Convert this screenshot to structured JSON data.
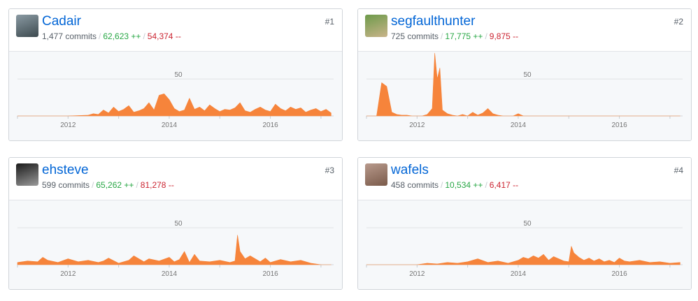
{
  "contributors": [
    {
      "username": "Cadair",
      "rank": "#1",
      "commits": "1,477 commits",
      "additions": "62,623 ++",
      "deletions": "54,374 --",
      "avatar_colors": [
        "#8a9aa3",
        "#3d4a4f"
      ]
    },
    {
      "username": "segfaulthunter",
      "rank": "#2",
      "commits": "725 commits",
      "additions": "17,775 ++",
      "deletions": "9,875 --",
      "avatar_colors": [
        "#6d9a4a",
        "#c9b48a"
      ]
    },
    {
      "username": "ehsteve",
      "rank": "#3",
      "commits": "599 commits",
      "additions": "65,262 ++",
      "deletions": "81,278 --",
      "avatar_colors": [
        "#1a1a1a",
        "#9a9a9a"
      ]
    },
    {
      "username": "wafels",
      "rank": "#4",
      "commits": "458 commits",
      "additions": "10,534 ++",
      "deletions": "6,417 --",
      "avatar_colors": [
        "#b89a8c",
        "#7a5a4a"
      ]
    }
  ],
  "chart_data": [
    {
      "type": "area",
      "series_of": "Cadair",
      "x": [
        2011.0,
        2011.5,
        2012.0,
        2012.4,
        2012.5,
        2012.6,
        2012.7,
        2012.8,
        2012.9,
        2013.0,
        2013.1,
        2013.2,
        2013.3,
        2013.4,
        2013.5,
        2013.6,
        2013.7,
        2013.8,
        2013.9,
        2014.0,
        2014.1,
        2014.2,
        2014.3,
        2014.4,
        2014.5,
        2014.6,
        2014.7,
        2014.8,
        2014.9,
        2015.0,
        2015.1,
        2015.2,
        2015.3,
        2015.4,
        2015.5,
        2015.6,
        2015.7,
        2015.8,
        2015.9,
        2016.0,
        2016.1,
        2016.2,
        2016.3,
        2016.4,
        2016.5,
        2016.6,
        2016.7,
        2016.8,
        2016.9,
        2017.0,
        2017.1,
        2017.2
      ],
      "values": [
        0,
        0,
        0,
        1,
        3,
        2,
        8,
        4,
        12,
        6,
        9,
        14,
        5,
        7,
        10,
        18,
        8,
        28,
        30,
        22,
        10,
        6,
        8,
        24,
        9,
        12,
        7,
        15,
        10,
        6,
        9,
        8,
        11,
        18,
        7,
        5,
        9,
        12,
        8,
        6,
        16,
        10,
        7,
        12,
        9,
        11,
        5,
        8,
        10,
        6,
        9,
        4
      ],
      "xlim": [
        2011.0,
        2017.25
      ],
      "ylim": [
        0,
        70
      ],
      "yticks": [
        50
      ],
      "xticks": [
        "2012",
        "2014",
        "2016"
      ],
      "color": "#f6843b"
    },
    {
      "type": "area",
      "series_of": "segfaulthunter",
      "x": [
        2011.0,
        2011.2,
        2011.3,
        2011.4,
        2011.5,
        2011.6,
        2011.7,
        2011.8,
        2011.9,
        2012.0,
        2012.1,
        2012.2,
        2012.3,
        2012.35,
        2012.4,
        2012.45,
        2012.5,
        2012.6,
        2012.7,
        2012.8,
        2012.9,
        2013.0,
        2013.1,
        2013.2,
        2013.3,
        2013.4,
        2013.5,
        2013.6,
        2013.7,
        2013.8,
        2013.9,
        2014.0,
        2014.1,
        2014.2,
        2014.5,
        2015.0,
        2016.0,
        2017.0,
        2017.2
      ],
      "values": [
        0,
        0,
        45,
        40,
        5,
        2,
        1,
        1,
        0,
        0,
        0,
        2,
        10,
        85,
        50,
        65,
        8,
        3,
        1,
        0,
        2,
        0,
        5,
        1,
        4,
        10,
        3,
        1,
        0,
        0,
        0,
        3,
        0,
        0,
        0,
        0,
        0,
        0,
        0
      ],
      "xlim": [
        2011.0,
        2017.25
      ],
      "ylim": [
        0,
        70
      ],
      "yticks": [
        50
      ],
      "xticks": [
        "2012",
        "2014",
        "2016"
      ],
      "color": "#f6843b"
    },
    {
      "type": "area",
      "series_of": "ehsteve",
      "x": [
        2011.0,
        2011.2,
        2011.4,
        2011.5,
        2011.6,
        2011.8,
        2012.0,
        2012.2,
        2012.4,
        2012.6,
        2012.7,
        2012.8,
        2013.0,
        2013.2,
        2013.3,
        2013.5,
        2013.6,
        2013.8,
        2014.0,
        2014.1,
        2014.2,
        2014.3,
        2014.4,
        2014.5,
        2014.6,
        2014.8,
        2015.0,
        2015.2,
        2015.3,
        2015.35,
        2015.4,
        2015.5,
        2015.6,
        2015.8,
        2015.9,
        2016.0,
        2016.2,
        2016.4,
        2016.6,
        2016.8,
        2017.0,
        2017.2
      ],
      "values": [
        3,
        5,
        4,
        10,
        6,
        3,
        8,
        4,
        6,
        3,
        5,
        9,
        2,
        6,
        12,
        4,
        8,
        5,
        10,
        4,
        7,
        18,
        3,
        14,
        5,
        4,
        6,
        3,
        5,
        40,
        18,
        8,
        12,
        4,
        9,
        3,
        7,
        4,
        6,
        2,
        0,
        0
      ],
      "xlim": [
        2011.0,
        2017.25
      ],
      "ylim": [
        0,
        70
      ],
      "yticks": [
        50
      ],
      "xticks": [
        "2012",
        "2014",
        "2016"
      ],
      "color": "#f6843b"
    },
    {
      "type": "area",
      "series_of": "wafels",
      "x": [
        2011.0,
        2011.5,
        2012.0,
        2012.2,
        2012.4,
        2012.6,
        2012.8,
        2013.0,
        2013.2,
        2013.4,
        2013.6,
        2013.8,
        2014.0,
        2014.1,
        2014.2,
        2014.3,
        2014.4,
        2014.5,
        2014.6,
        2014.7,
        2014.8,
        2014.9,
        2015.0,
        2015.05,
        2015.1,
        2015.2,
        2015.3,
        2015.4,
        2015.5,
        2015.6,
        2015.7,
        2015.8,
        2015.9,
        2016.0,
        2016.1,
        2016.2,
        2016.4,
        2016.6,
        2016.8,
        2017.0,
        2017.2
      ],
      "values": [
        0,
        0,
        0,
        2,
        1,
        3,
        2,
        4,
        8,
        3,
        5,
        2,
        6,
        10,
        8,
        12,
        9,
        14,
        6,
        11,
        8,
        5,
        4,
        25,
        16,
        10,
        6,
        9,
        5,
        8,
        4,
        6,
        3,
        9,
        5,
        4,
        6,
        3,
        4,
        2,
        3
      ],
      "xlim": [
        2011.0,
        2017.25
      ],
      "ylim": [
        0,
        70
      ],
      "yticks": [
        50
      ],
      "xticks": [
        "2012",
        "2014",
        "2016"
      ],
      "color": "#f6843b"
    }
  ]
}
